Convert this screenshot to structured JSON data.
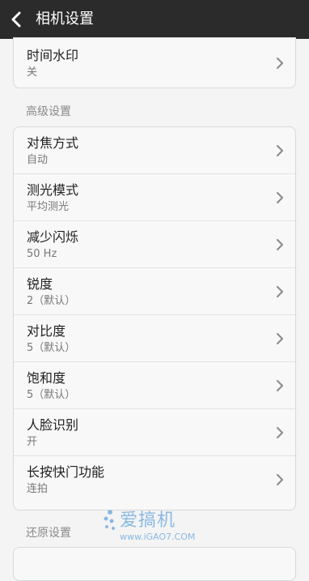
{
  "header": {
    "title": "相机设置"
  },
  "top_item": {
    "title": "时间水印",
    "value": "关"
  },
  "sections": {
    "advanced": "高级设置",
    "restore": "还原设置"
  },
  "advanced_items": [
    {
      "title": "对焦方式",
      "value": "自动"
    },
    {
      "title": "测光模式",
      "value": "平均测光"
    },
    {
      "title": "减少闪烁",
      "value": "50 Hz"
    },
    {
      "title": "锐度",
      "value": "2（默认）"
    },
    {
      "title": "对比度",
      "value": "5（默认）"
    },
    {
      "title": "饱和度",
      "value": "5（默认）"
    },
    {
      "title": "人脸识别",
      "value": "开"
    },
    {
      "title": "长按快门功能",
      "value": "连拍"
    }
  ],
  "watermark": {
    "brand": "爱搞机",
    "url": "www.iGAO7.COM"
  },
  "colors": {
    "header_bg": "#2b2b2b",
    "page_bg": "#f4f4f4",
    "card_bg": "#f8f8f8",
    "watermark": "#7fb2e2"
  },
  "icons": {
    "back": "chevron-left-icon",
    "item_arrow": "chevron-right-icon"
  }
}
